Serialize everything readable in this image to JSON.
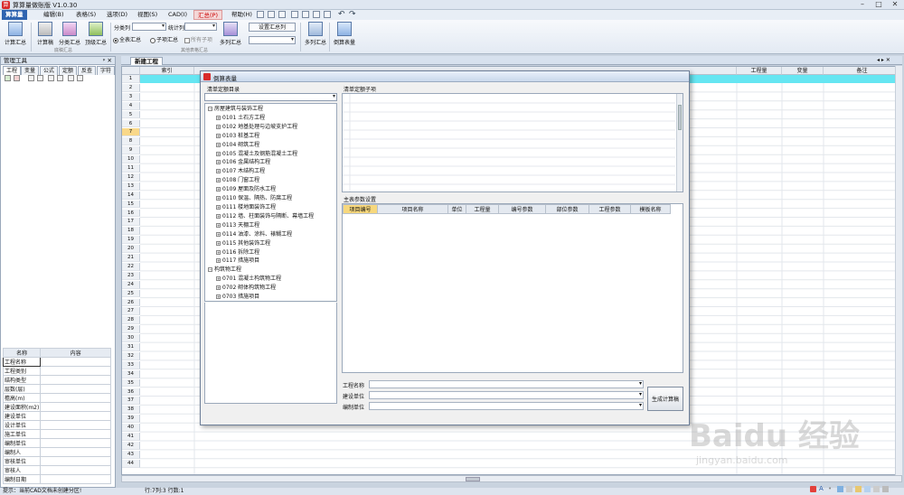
{
  "app": {
    "title": "算算量做账版 V1.0.30",
    "logo": "算"
  },
  "window": {
    "min": "–",
    "max": "□",
    "close": "✕"
  },
  "menu": {
    "items": [
      "算算量",
      "编辑(B)",
      "表格(S)",
      "选项(D)",
      "视图(S)",
      "CAD(I)",
      "汇总(P)",
      "帮助(H)"
    ],
    "active": 0,
    "highlight": 6
  },
  "ribbon": {
    "calc_summary": "计算汇总",
    "calc_sheet": "计算稿",
    "sub_summary": "分类汇总",
    "top_summary": "顶级汇总",
    "group1": "底稿汇总",
    "class_col": "分类列",
    "stat_col": "统计列",
    "radio_all": "全表汇总",
    "radio_child": "子项汇总",
    "chk_all_sub": "所有子项",
    "multi_summary": "多列汇总",
    "settings_summary": "设置汇总列",
    "list_summary": "多列汇总",
    "group2": "其他表格汇总",
    "reverse_table": "倒算表量"
  },
  "left": {
    "header": "管理工具",
    "pin": "ᵖ ✕",
    "tabs": [
      "工程",
      "变量",
      "公式",
      "定额",
      "反查",
      "字符"
    ],
    "table_head": [
      "名称",
      "内容"
    ],
    "rows": [
      "工程名称",
      "工程类别",
      "结构类型",
      "层数(层)",
      "檐高(m)",
      "建设面积(m2)",
      "建设单位",
      "设计单位",
      "施工单位",
      "编制单位",
      "编制人",
      "审核单位",
      "审核人",
      "编制日期"
    ]
  },
  "doc": {
    "tab": "新建工程",
    "cols": [
      "索引",
      "工程量",
      "变量",
      "备注"
    ],
    "rows": 44,
    "selected_row": 7
  },
  "dialog": {
    "title": "倒算表量",
    "left_label": "清单定额目录",
    "right_label": "清单定额子项",
    "params_label": "主表参数设置",
    "tree": [
      {
        "lvl": 0,
        "t": "房屋建筑与装饰工程",
        "exp": "−"
      },
      {
        "lvl": 1,
        "t": "0101 土石方工程"
      },
      {
        "lvl": 1,
        "t": "0102 地基处理与边坡支护工程"
      },
      {
        "lvl": 1,
        "t": "0103 桩基工程"
      },
      {
        "lvl": 1,
        "t": "0104 砌筑工程"
      },
      {
        "lvl": 1,
        "t": "0105 混凝土及钢筋混凝土工程"
      },
      {
        "lvl": 1,
        "t": "0106 金属结构工程"
      },
      {
        "lvl": 1,
        "t": "0107 木结构工程"
      },
      {
        "lvl": 1,
        "t": "0108 门窗工程"
      },
      {
        "lvl": 1,
        "t": "0109 屋面及防水工程"
      },
      {
        "lvl": 1,
        "t": "0110 保温、隔热、防腐工程"
      },
      {
        "lvl": 1,
        "t": "0111 楼地面装饰工程"
      },
      {
        "lvl": 1,
        "t": "0112 墙、柱面装饰与隔断、幕墙工程"
      },
      {
        "lvl": 1,
        "t": "0113 天棚工程"
      },
      {
        "lvl": 1,
        "t": "0114 油漆、涂料、裱糊工程"
      },
      {
        "lvl": 1,
        "t": "0115 其他装饰工程"
      },
      {
        "lvl": 1,
        "t": "0116 拆除工程"
      },
      {
        "lvl": 1,
        "t": "0117 措施项目"
      },
      {
        "lvl": 0,
        "t": "构筑物工程",
        "exp": "−"
      },
      {
        "lvl": 1,
        "t": "0701 混凝土构筑物工程"
      },
      {
        "lvl": 1,
        "t": "0702 砌体构筑物工程"
      },
      {
        "lvl": 1,
        "t": "0703 措施项目"
      }
    ],
    "param_cols": [
      "项目编号",
      "项目名称",
      "单位",
      "工程量",
      "编号参数",
      "部位参数",
      "工程参数",
      "模板名称"
    ],
    "project_name": "工程名称",
    "build_unit": "建设单位",
    "edit_unit": "编制单位",
    "generate": "生成计算稿"
  },
  "status": {
    "hint": "提示：当前CAD文档未创建分区!",
    "pos": "行:7列:3 行数:1"
  },
  "watermark": {
    "main": "Baidu 经验",
    "sub": "jingyan.baidu.com"
  }
}
